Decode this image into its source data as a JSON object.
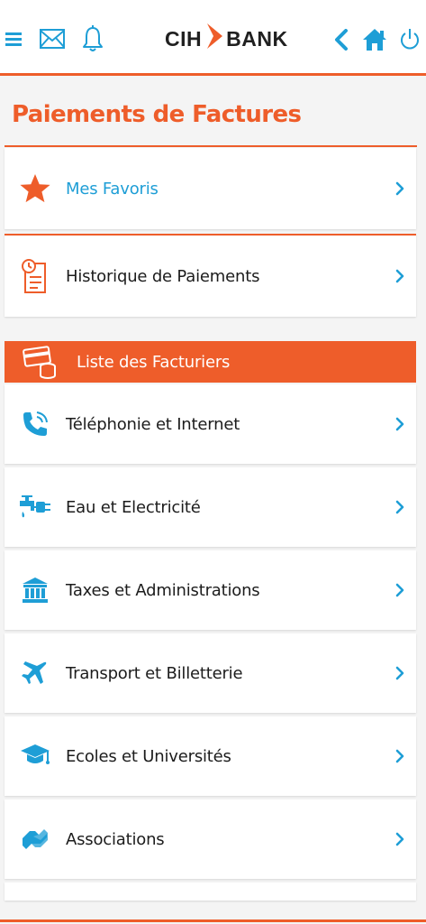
{
  "header": {
    "logo_left": "CIH",
    "logo_right": "BANK",
    "accent": "#ee5d2a",
    "icon_color": "#1e9ed6"
  },
  "page": {
    "title": "Paiements de Factures"
  },
  "shortcuts": [
    {
      "label": "Mes Favoris",
      "icon": "star-icon"
    },
    {
      "label": "Historique de Paiements",
      "icon": "history-document-icon"
    }
  ],
  "billers_section": {
    "label": "Liste des Facturiers",
    "icon": "card-coins-icon"
  },
  "billers": [
    {
      "label": "Téléphonie et Internet",
      "icon": "phone-icon"
    },
    {
      "label": "Eau et Electricité",
      "icon": "water-electricity-icon"
    },
    {
      "label": "Taxes et Administrations",
      "icon": "bank-building-icon"
    },
    {
      "label": "Transport et Billetterie",
      "icon": "airplane-icon"
    },
    {
      "label": "Ecoles et Universités",
      "icon": "graduation-cap-icon"
    },
    {
      "label": "Associations",
      "icon": "handshake-icon"
    }
  ]
}
